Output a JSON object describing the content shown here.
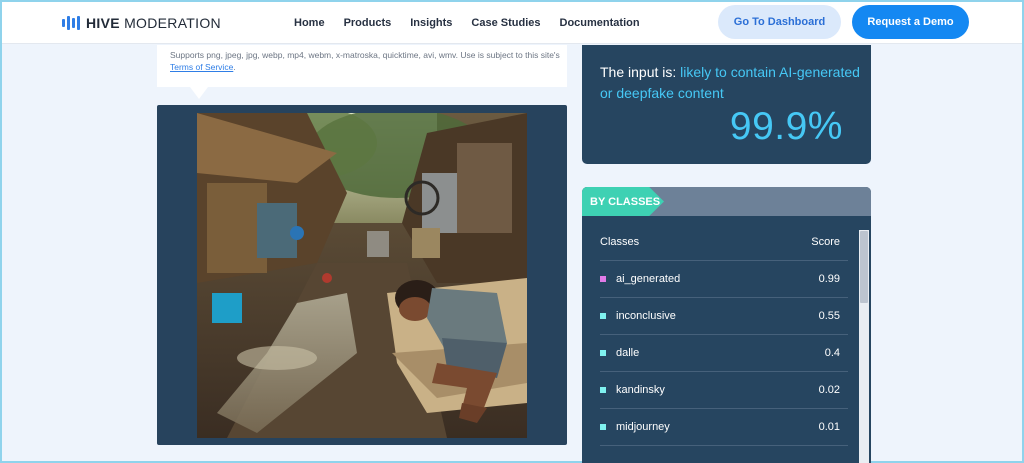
{
  "header": {
    "logo_bold": "HIVE",
    "logo_light": " MODERATION",
    "nav": [
      "Home",
      "Products",
      "Insights",
      "Case Studies",
      "Documentation"
    ],
    "dashboard_label": "Go To Dashboard",
    "demo_label": "Request a Demo",
    "colors": {
      "accent": "#1488f2",
      "dashboard_bg": "#dbe9fb"
    }
  },
  "upload": {
    "supports_text": "Supports png, jpeg, jpg, webp, mp4, webm, x-matroska, quicktime, avi, wmv. Use is subject to this site's ",
    "terms_link": "Terms of Service",
    "terms_suffix": "."
  },
  "result": {
    "prefix": "The input is: ",
    "verdict": "likely to contain AI-generated or deepfake content",
    "percent": "99.9%",
    "highlight_color": "#46c8f5"
  },
  "classes": {
    "tab_label": "BY CLASSES",
    "col_classes": "Classes",
    "col_score": "Score",
    "rows": [
      {
        "name": "ai_generated",
        "score": "0.99",
        "color": "#e07be8"
      },
      {
        "name": "inconclusive",
        "score": "0.55",
        "color": "#7ff1ef"
      },
      {
        "name": "dalle",
        "score": "0.4",
        "color": "#7ff1ef"
      },
      {
        "name": "kandinsky",
        "score": "0.02",
        "color": "#7ff1ef"
      },
      {
        "name": "midjourney",
        "score": "0.01",
        "color": "#7ff1ef"
      }
    ]
  }
}
